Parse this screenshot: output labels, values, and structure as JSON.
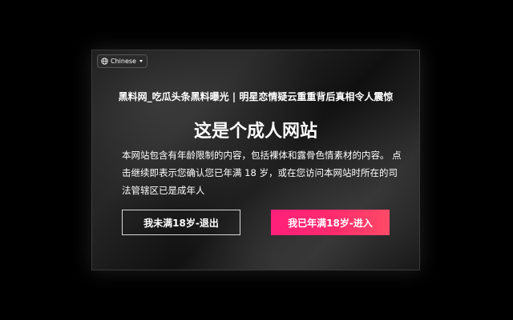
{
  "language_selector": {
    "label": "Chinese",
    "icon": "globe-icon"
  },
  "site_title": "黑料网_吃瓜头条黑料曝光 | 明星恋情疑云重重背后真相令人震惊",
  "headline": "这是个成人网站",
  "description": "本网站包含有年龄限制的内容，包括裸体和露骨色情素材的内容。 点击继续即表示您确认您已年满 18 岁，或在您访问本网站时所在的司法管辖区已是成年人",
  "buttons": {
    "exit_label": "我未满18岁-退出",
    "enter_label": "我已年满18岁-进入"
  },
  "colors": {
    "enter_button": "#ff2a6e",
    "background": "#000000",
    "text": "#ffffff"
  }
}
